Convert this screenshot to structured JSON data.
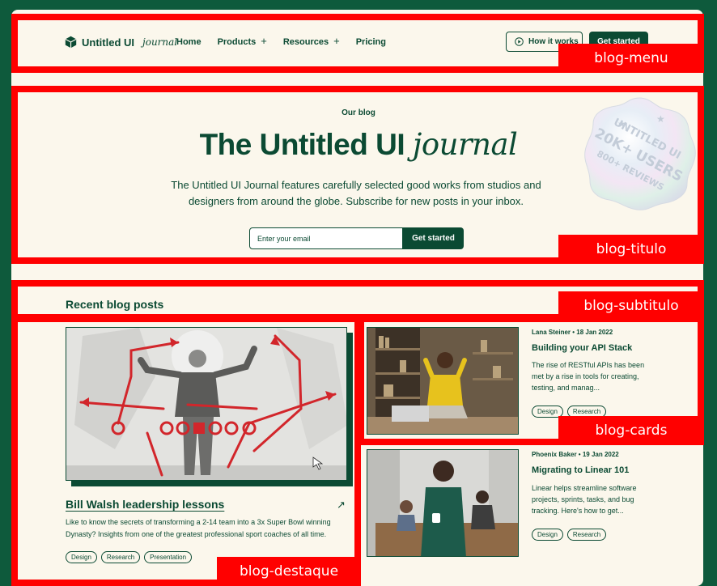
{
  "nav": {
    "logo_text": "Untitled UI",
    "logo_journal": "journal",
    "links": [
      {
        "label": "Home"
      },
      {
        "label": "Products",
        "plus": "+"
      },
      {
        "label": "Resources",
        "plus": "+"
      },
      {
        "label": "Pricing"
      }
    ],
    "how_button": "How it works",
    "get_started": "Get started"
  },
  "hero": {
    "eyebrow": "Our blog",
    "title_main": "The Untitled UI",
    "title_italic": "journal",
    "description": "The Untitled UI Journal features carefully selected good works from studios and designers from around the globe. Subscribe for new posts in your inbox.",
    "email_placeholder": "Enter your email",
    "button": "Get started",
    "badge_line1": "UNTITLED UI",
    "badge_line2": "20K+ USERS",
    "badge_line3": "800+ REVIEWS"
  },
  "section": {
    "title": "Recent blog posts"
  },
  "featured": {
    "title": "Bill Walsh leadership lessons",
    "arrow": "↗",
    "description": "Like to know the secrets of transforming a 2-14 team into a 3x Super Bowl winning Dynasty? Insights from one of the greatest professional sport coaches of all time.",
    "tags": [
      "Design",
      "Research",
      "Presentation"
    ]
  },
  "cards": [
    {
      "meta": "Lana Steiner • 18 Jan 2022",
      "title": "Building your API Stack",
      "description": "The rise of RESTful APIs has been met by a rise in tools for creating, testing, and manag...",
      "tags": [
        "Design",
        "Research"
      ]
    },
    {
      "meta": "Phoenix Baker • 19 Jan 2022",
      "title": "Migrating to Linear 101",
      "description": "Linear helps streamline software projects, sprints, tasks, and bug tracking. Here's how to get...",
      "tags": [
        "Design",
        "Research"
      ]
    }
  ],
  "annotations": {
    "menu": "blog-menu",
    "titulo": "blog-titulo",
    "subtitulo": "blog-subtitulo",
    "cards": "blog-cards",
    "destaque": "blog-destaque"
  },
  "colors": {
    "brand": "#0b4a33",
    "background": "#fbf7ec",
    "annotation": "#ff0000"
  }
}
